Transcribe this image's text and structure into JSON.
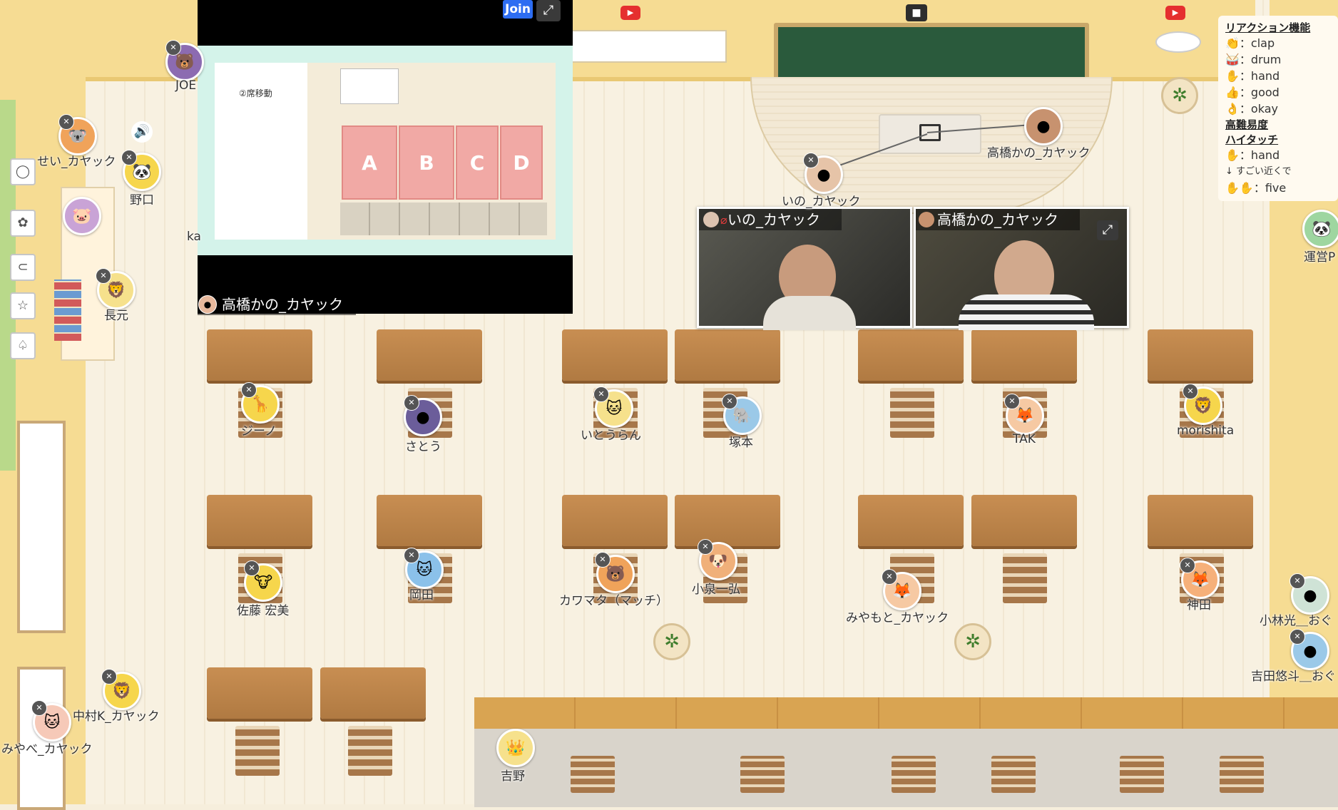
{
  "screen_share": {
    "join_label": "Join",
    "expand_icon": "expand-icon",
    "slide_heading": "②席移動",
    "room_labels": [
      "A",
      "B",
      "C",
      "D"
    ],
    "presenter": "高橋かの_カヤック"
  },
  "videos": [
    {
      "name": "いの_カヤック",
      "muted": true
    },
    {
      "name": "高橋かの_カヤック",
      "muted": false
    }
  ],
  "reaction_panel": {
    "title": "リアクション機能",
    "reactions": [
      {
        "icon": "👏",
        "label": "：clap"
      },
      {
        "icon": "🥁",
        "label": "：drum"
      },
      {
        "icon": "✋",
        "label": "：hand"
      },
      {
        "icon": "👍",
        "label": "：good"
      },
      {
        "icon": "👌",
        "label": "：okay"
      }
    ],
    "difficulty_title": "高難易度",
    "hightouch_title": "ハイタッチ",
    "hightouch": [
      {
        "icon": "✋",
        "label": "：hand"
      },
      {
        "icon": "↓",
        "label": "すごい近くで"
      },
      {
        "icon": "✋✋",
        "label": "：five"
      }
    ]
  },
  "avatars": {
    "joe": "JOE",
    "sei": "せい_カヤック",
    "noguchi": "野口",
    "ka": "ka",
    "nagamoto": "長元",
    "ino_stage": "いの_カヤック",
    "takahashi_stage": "高橋かの_カヤック",
    "unei": "運営P",
    "jin": "ジーノ",
    "sato": "さとう",
    "itou": "いとうらん",
    "tsukamoto": "塚本",
    "tak": "TAK",
    "morishita": "morishita",
    "sato_hiromi": "佐藤 宏美",
    "okada": "岡田",
    "kawamata": "カワマタ（マッチ）",
    "koizumi": "小泉一弘",
    "miyamoto": "みやもと_カヤック",
    "kanda": "神田",
    "kobayashi": "小林光＿おぐ",
    "yoshida": "吉田悠斗＿おぐ",
    "nakamura": "中村K_カヤック",
    "miyabe": "みやべ_カヤック",
    "yoshino": "吉野"
  }
}
